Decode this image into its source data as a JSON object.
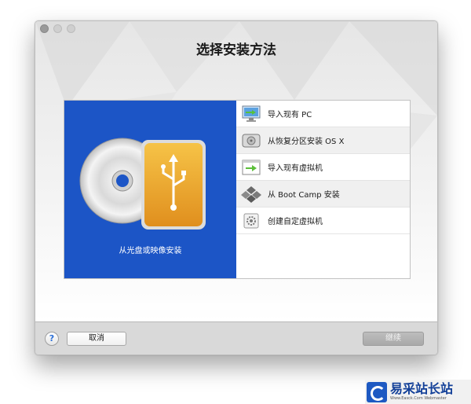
{
  "window": {
    "title": "选择安装方法"
  },
  "left_pane": {
    "caption": "从光盘或映像安装"
  },
  "options": [
    {
      "label": "导入现有 PC",
      "icon": "pc-monitor-icon"
    },
    {
      "label": "从恢复分区安装 OS X",
      "icon": "hard-drive-icon"
    },
    {
      "label": "导入现有虚拟机",
      "icon": "virtual-machine-icon"
    },
    {
      "label": "从 Boot Camp 安装",
      "icon": "boot-camp-icon"
    },
    {
      "label": "创建自定虚拟机",
      "icon": "custom-vm-gear-icon"
    }
  ],
  "footer": {
    "help_label": "?",
    "cancel_label": "取消",
    "continue_label": "继续"
  },
  "watermark": {
    "title": "易采站长站",
    "subtitle": "Www.Easck.Com  Webmaster"
  },
  "colors": {
    "left_pane_blue": "#1c55c6",
    "disabled_button": "#b3b3b3"
  }
}
